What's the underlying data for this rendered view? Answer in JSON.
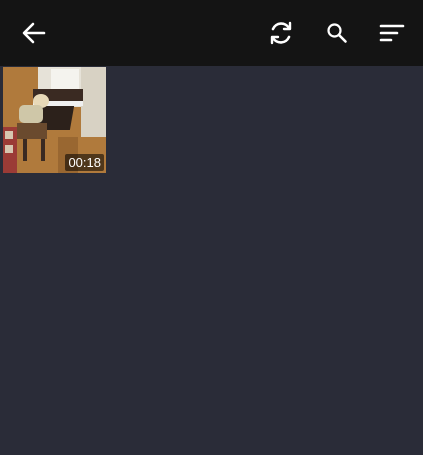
{
  "toolbar": {
    "back_icon": "arrow-left-icon",
    "refresh_icon": "refresh-icon",
    "search_icon": "search-icon",
    "sort_icon": "sort-icon"
  },
  "videos": [
    {
      "thumbnail": "video-thumbnail-piano",
      "duration": "00:18"
    }
  ],
  "colors": {
    "toolbar_bg": "#141414",
    "content_bg": "#2a2c38",
    "icon": "#ffffff"
  }
}
